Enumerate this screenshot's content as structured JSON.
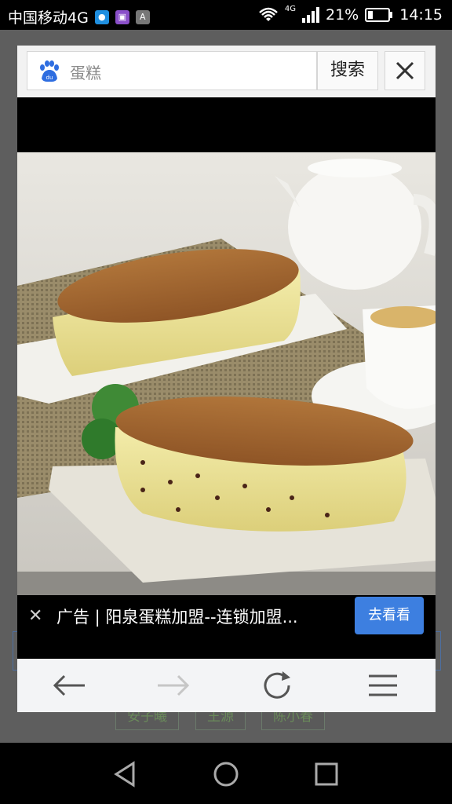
{
  "status_bar": {
    "carrier": "中国移动4G",
    "network": "4G",
    "battery": "21%",
    "time": "14:15",
    "notif_icons": [
      "chat-icon",
      "gallery-icon",
      "app-a-icon"
    ]
  },
  "background_page": {
    "chips": [
      "安子曦",
      "王源",
      "陈小春"
    ]
  },
  "search": {
    "query": "蛋糕",
    "button_label": "搜索"
  },
  "ad": {
    "text": "广告 | 阳泉蛋糕加盟--连锁加盟...",
    "button_label": "去看看"
  },
  "nav": {
    "icons": [
      "back-arrow-icon",
      "forward-arrow-icon",
      "refresh-icon",
      "menu-icon"
    ]
  },
  "colors": {
    "accent": "#3d7fe0",
    "baidu_blue": "#2e6de0"
  }
}
